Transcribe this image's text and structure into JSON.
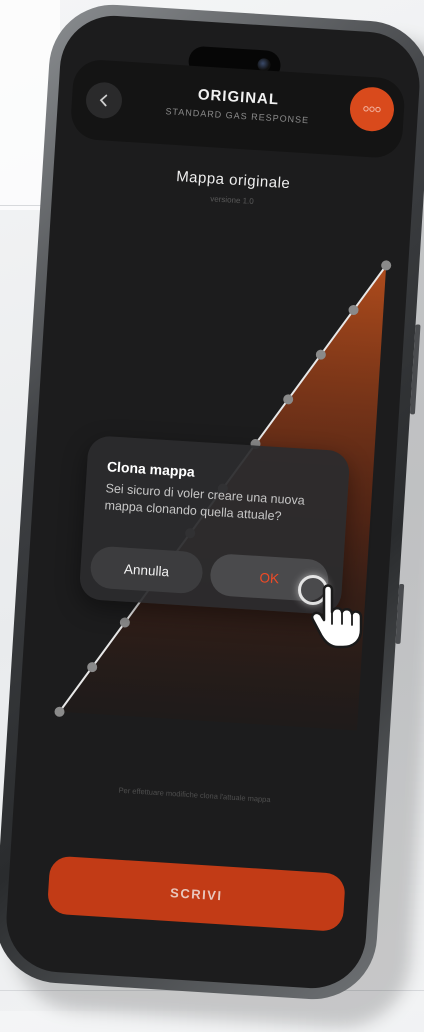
{
  "header": {
    "title": "ORIGINAL",
    "subtitle": "STANDARD GAS RESPONSE",
    "back_icon": "chevron-left-icon",
    "more_icon": "more-dots-icon"
  },
  "map": {
    "title": "Mappa originale",
    "version": "versione 1.0"
  },
  "chart_data": {
    "type": "line",
    "x": [
      0,
      1,
      2,
      3,
      4,
      5,
      6,
      7,
      8,
      9,
      10
    ],
    "series": [
      {
        "values": [
          0,
          10,
          20,
          30,
          40,
          50,
          60,
          70,
          80,
          90,
          100
        ]
      }
    ],
    "xlim": [
      0,
      10
    ],
    "ylim": [
      0,
      100
    ],
    "grid": false,
    "line_color": "#e8e8e8",
    "marker_color": "#8a8a8a",
    "fill_color": "#c9541c"
  },
  "dialog": {
    "title": "Clona mappa",
    "message": "Sei sicuro di voler creare una nuova mappa clonando quella attuale?",
    "cancel_label": "Annulla",
    "ok_label": "OK"
  },
  "hint": "Per effettuare modifiche clona l'attuale mappa",
  "write_button": "SCRIVI",
  "colors": {
    "accent": "#d94a1c",
    "button": "#c23b16",
    "screen_background": "#1c1c1d",
    "ok_text": "#ef4a26"
  },
  "cursor_icon": "tap-hand-icon"
}
